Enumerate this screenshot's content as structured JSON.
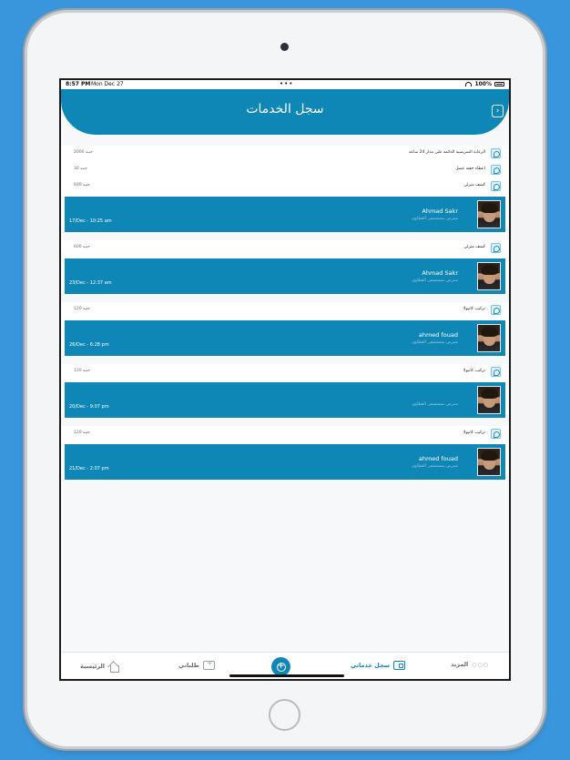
{
  "status_bar": {
    "time": "8:57 PM",
    "date": "Mon Dec 27",
    "battery": "100%"
  },
  "header": {
    "title": "سجل الخدمات",
    "back_icon": "chevron-right-icon"
  },
  "colors": {
    "brand": "#0e86b6",
    "background": "#3a96dc"
  },
  "history": [
    {
      "services": [
        {
          "name": "الرعاية التمريضية الدائمة علي مدار 24 ساعه",
          "price": "2000 جنيه"
        },
        {
          "name": "اعطاء حقنه عضل",
          "price": "30 جنيه"
        },
        {
          "name": "كشف منزلي",
          "price": "600 جنيه"
        }
      ],
      "provider": {
        "name": "Ahmad Sakr",
        "specialty": "ممرض بمستشفى القطاوي",
        "date": "17/Dec - 10:25 am"
      }
    },
    {
      "services": [
        {
          "name": "كشف منزلي",
          "price": "600 جنيه"
        }
      ],
      "provider": {
        "name": "Ahmad Sakr",
        "specialty": "ممرض بمستشفى القطاوي",
        "date": "23/Dec - 12:37 am"
      }
    },
    {
      "services": [
        {
          "name": "تركيب كانيولا",
          "price": "120 جنيه"
        }
      ],
      "provider": {
        "name": "ahmed fouad",
        "specialty": "ممرض بمستشفى القطاوي",
        "date": "26/Dec - 6:28 pm"
      }
    },
    {
      "services": [
        {
          "name": "تركيب كانيولا",
          "price": "120 جنيه"
        }
      ],
      "provider": {
        "name": "",
        "specialty": "ممرض بمستشفى القطاوي",
        "date": "20/Dec - 9:07 pm"
      }
    },
    {
      "services": [
        {
          "name": "تركيب كانيولا",
          "price": "120 جنيه"
        }
      ],
      "provider": {
        "name": "ahmed fouad",
        "specialty": "ممرض بمستشفى القطاوي",
        "date": "21/Dec - 2:07 pm"
      }
    }
  ],
  "tabbar": {
    "more": "المزيد",
    "history": "سجل خدماتي",
    "orders": "طلباتي",
    "home": "الرئيسية"
  }
}
